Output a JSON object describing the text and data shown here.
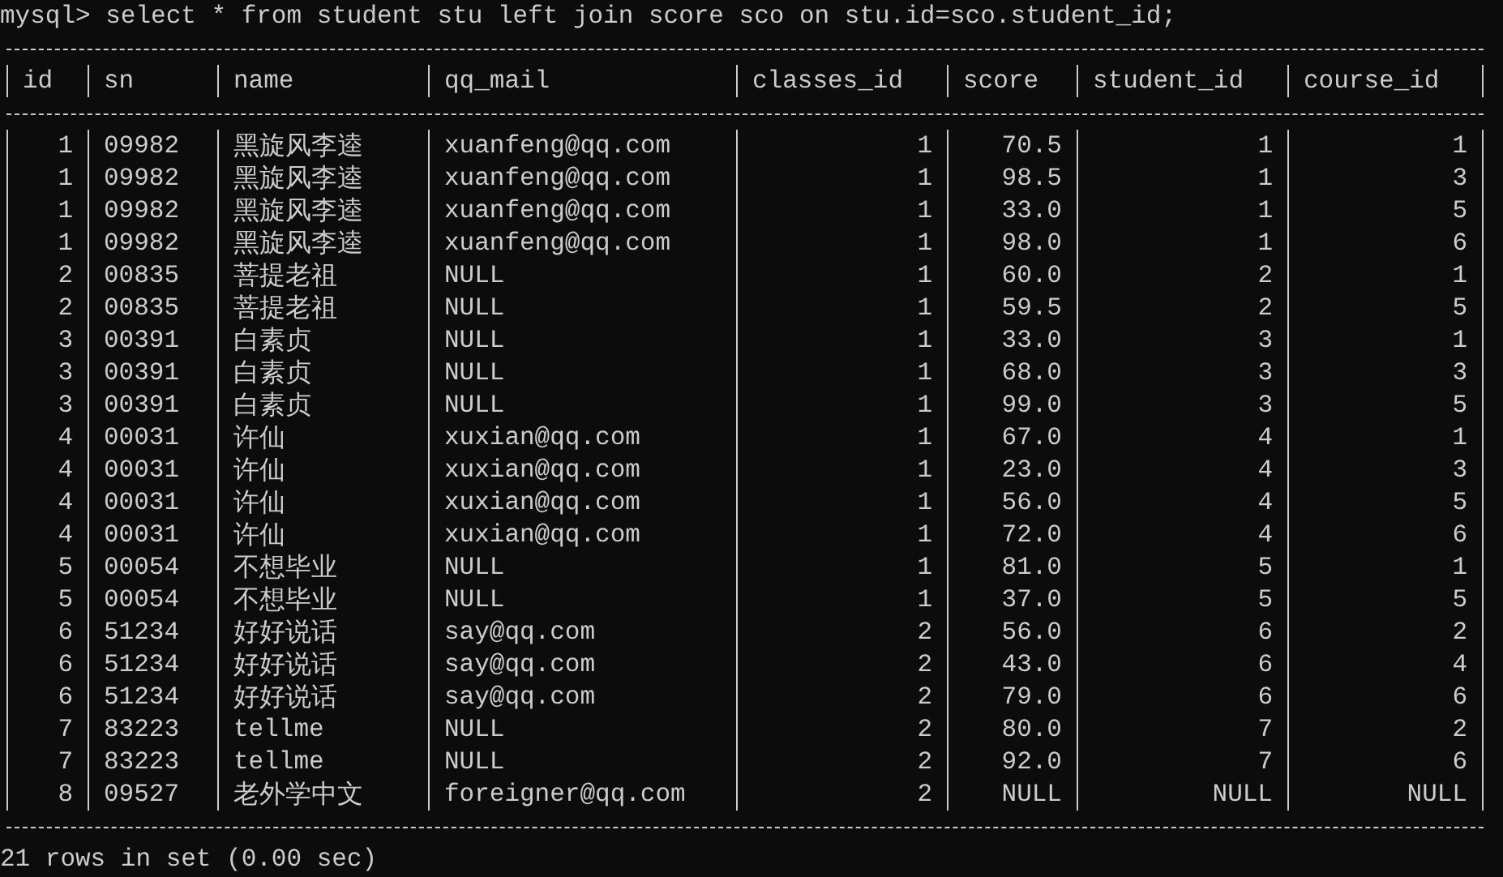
{
  "command_line": "mysql> select * from student stu left join score sco on stu.id=sco.student_id;",
  "table": {
    "columns": [
      {
        "name": "id",
        "numeric": true
      },
      {
        "name": "sn",
        "numeric": false
      },
      {
        "name": "name",
        "numeric": false
      },
      {
        "name": "qq_mail",
        "numeric": false
      },
      {
        "name": "classes_id",
        "numeric": true
      },
      {
        "name": "score",
        "numeric": true
      },
      {
        "name": "student_id",
        "numeric": true
      },
      {
        "name": "course_id",
        "numeric": true
      }
    ],
    "rows": [
      [
        "1",
        "09982",
        "黑旋风李逵",
        "xuanfeng@qq.com",
        "1",
        "70.5",
        "1",
        "1"
      ],
      [
        "1",
        "09982",
        "黑旋风李逵",
        "xuanfeng@qq.com",
        "1",
        "98.5",
        "1",
        "3"
      ],
      [
        "1",
        "09982",
        "黑旋风李逵",
        "xuanfeng@qq.com",
        "1",
        "33.0",
        "1",
        "5"
      ],
      [
        "1",
        "09982",
        "黑旋风李逵",
        "xuanfeng@qq.com",
        "1",
        "98.0",
        "1",
        "6"
      ],
      [
        "2",
        "00835",
        "菩提老祖",
        "NULL",
        "1",
        "60.0",
        "2",
        "1"
      ],
      [
        "2",
        "00835",
        "菩提老祖",
        "NULL",
        "1",
        "59.5",
        "2",
        "5"
      ],
      [
        "3",
        "00391",
        "白素贞",
        "NULL",
        "1",
        "33.0",
        "3",
        "1"
      ],
      [
        "3",
        "00391",
        "白素贞",
        "NULL",
        "1",
        "68.0",
        "3",
        "3"
      ],
      [
        "3",
        "00391",
        "白素贞",
        "NULL",
        "1",
        "99.0",
        "3",
        "5"
      ],
      [
        "4",
        "00031",
        "许仙",
        "xuxian@qq.com",
        "1",
        "67.0",
        "4",
        "1"
      ],
      [
        "4",
        "00031",
        "许仙",
        "xuxian@qq.com",
        "1",
        "23.0",
        "4",
        "3"
      ],
      [
        "4",
        "00031",
        "许仙",
        "xuxian@qq.com",
        "1",
        "56.0",
        "4",
        "5"
      ],
      [
        "4",
        "00031",
        "许仙",
        "xuxian@qq.com",
        "1",
        "72.0",
        "4",
        "6"
      ],
      [
        "5",
        "00054",
        "不想毕业",
        "NULL",
        "1",
        "81.0",
        "5",
        "1"
      ],
      [
        "5",
        "00054",
        "不想毕业",
        "NULL",
        "1",
        "37.0",
        "5",
        "5"
      ],
      [
        "6",
        "51234",
        "好好说话",
        "say@qq.com",
        "2",
        "56.0",
        "6",
        "2"
      ],
      [
        "6",
        "51234",
        "好好说话",
        "say@qq.com",
        "2",
        "43.0",
        "6",
        "4"
      ],
      [
        "6",
        "51234",
        "好好说话",
        "say@qq.com",
        "2",
        "79.0",
        "6",
        "6"
      ],
      [
        "7",
        "83223",
        "tellme",
        "NULL",
        "2",
        "80.0",
        "7",
        "2"
      ],
      [
        "7",
        "83223",
        "tellme",
        "NULL",
        "2",
        "92.0",
        "7",
        "6"
      ],
      [
        "8",
        "09527",
        "老外学中文",
        "foreigner@qq.com",
        "2",
        "NULL",
        "NULL",
        "NULL"
      ]
    ]
  },
  "result_summary": "21 rows in set (0.00 sec)"
}
